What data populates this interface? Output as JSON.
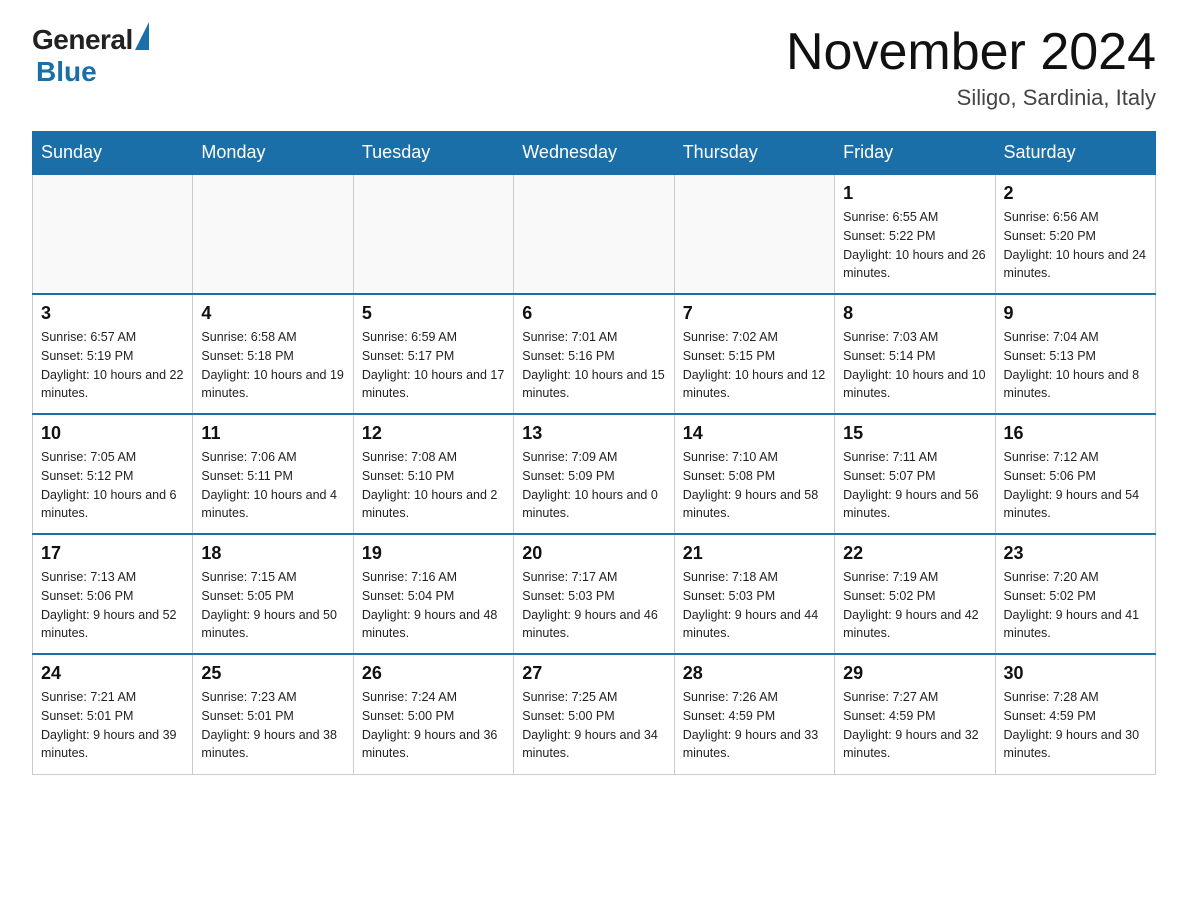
{
  "header": {
    "logo_general": "General",
    "logo_blue": "Blue",
    "month_title": "November 2024",
    "location": "Siligo, Sardinia, Italy"
  },
  "weekdays": [
    "Sunday",
    "Monday",
    "Tuesday",
    "Wednesday",
    "Thursday",
    "Friday",
    "Saturday"
  ],
  "weeks": [
    [
      {
        "day": "",
        "info": ""
      },
      {
        "day": "",
        "info": ""
      },
      {
        "day": "",
        "info": ""
      },
      {
        "day": "",
        "info": ""
      },
      {
        "day": "",
        "info": ""
      },
      {
        "day": "1",
        "info": "Sunrise: 6:55 AM\nSunset: 5:22 PM\nDaylight: 10 hours and 26 minutes."
      },
      {
        "day": "2",
        "info": "Sunrise: 6:56 AM\nSunset: 5:20 PM\nDaylight: 10 hours and 24 minutes."
      }
    ],
    [
      {
        "day": "3",
        "info": "Sunrise: 6:57 AM\nSunset: 5:19 PM\nDaylight: 10 hours and 22 minutes."
      },
      {
        "day": "4",
        "info": "Sunrise: 6:58 AM\nSunset: 5:18 PM\nDaylight: 10 hours and 19 minutes."
      },
      {
        "day": "5",
        "info": "Sunrise: 6:59 AM\nSunset: 5:17 PM\nDaylight: 10 hours and 17 minutes."
      },
      {
        "day": "6",
        "info": "Sunrise: 7:01 AM\nSunset: 5:16 PM\nDaylight: 10 hours and 15 minutes."
      },
      {
        "day": "7",
        "info": "Sunrise: 7:02 AM\nSunset: 5:15 PM\nDaylight: 10 hours and 12 minutes."
      },
      {
        "day": "8",
        "info": "Sunrise: 7:03 AM\nSunset: 5:14 PM\nDaylight: 10 hours and 10 minutes."
      },
      {
        "day": "9",
        "info": "Sunrise: 7:04 AM\nSunset: 5:13 PM\nDaylight: 10 hours and 8 minutes."
      }
    ],
    [
      {
        "day": "10",
        "info": "Sunrise: 7:05 AM\nSunset: 5:12 PM\nDaylight: 10 hours and 6 minutes."
      },
      {
        "day": "11",
        "info": "Sunrise: 7:06 AM\nSunset: 5:11 PM\nDaylight: 10 hours and 4 minutes."
      },
      {
        "day": "12",
        "info": "Sunrise: 7:08 AM\nSunset: 5:10 PM\nDaylight: 10 hours and 2 minutes."
      },
      {
        "day": "13",
        "info": "Sunrise: 7:09 AM\nSunset: 5:09 PM\nDaylight: 10 hours and 0 minutes."
      },
      {
        "day": "14",
        "info": "Sunrise: 7:10 AM\nSunset: 5:08 PM\nDaylight: 9 hours and 58 minutes."
      },
      {
        "day": "15",
        "info": "Sunrise: 7:11 AM\nSunset: 5:07 PM\nDaylight: 9 hours and 56 minutes."
      },
      {
        "day": "16",
        "info": "Sunrise: 7:12 AM\nSunset: 5:06 PM\nDaylight: 9 hours and 54 minutes."
      }
    ],
    [
      {
        "day": "17",
        "info": "Sunrise: 7:13 AM\nSunset: 5:06 PM\nDaylight: 9 hours and 52 minutes."
      },
      {
        "day": "18",
        "info": "Sunrise: 7:15 AM\nSunset: 5:05 PM\nDaylight: 9 hours and 50 minutes."
      },
      {
        "day": "19",
        "info": "Sunrise: 7:16 AM\nSunset: 5:04 PM\nDaylight: 9 hours and 48 minutes."
      },
      {
        "day": "20",
        "info": "Sunrise: 7:17 AM\nSunset: 5:03 PM\nDaylight: 9 hours and 46 minutes."
      },
      {
        "day": "21",
        "info": "Sunrise: 7:18 AM\nSunset: 5:03 PM\nDaylight: 9 hours and 44 minutes."
      },
      {
        "day": "22",
        "info": "Sunrise: 7:19 AM\nSunset: 5:02 PM\nDaylight: 9 hours and 42 minutes."
      },
      {
        "day": "23",
        "info": "Sunrise: 7:20 AM\nSunset: 5:02 PM\nDaylight: 9 hours and 41 minutes."
      }
    ],
    [
      {
        "day": "24",
        "info": "Sunrise: 7:21 AM\nSunset: 5:01 PM\nDaylight: 9 hours and 39 minutes."
      },
      {
        "day": "25",
        "info": "Sunrise: 7:23 AM\nSunset: 5:01 PM\nDaylight: 9 hours and 38 minutes."
      },
      {
        "day": "26",
        "info": "Sunrise: 7:24 AM\nSunset: 5:00 PM\nDaylight: 9 hours and 36 minutes."
      },
      {
        "day": "27",
        "info": "Sunrise: 7:25 AM\nSunset: 5:00 PM\nDaylight: 9 hours and 34 minutes."
      },
      {
        "day": "28",
        "info": "Sunrise: 7:26 AM\nSunset: 4:59 PM\nDaylight: 9 hours and 33 minutes."
      },
      {
        "day": "29",
        "info": "Sunrise: 7:27 AM\nSunset: 4:59 PM\nDaylight: 9 hours and 32 minutes."
      },
      {
        "day": "30",
        "info": "Sunrise: 7:28 AM\nSunset: 4:59 PM\nDaylight: 9 hours and 30 minutes."
      }
    ]
  ]
}
